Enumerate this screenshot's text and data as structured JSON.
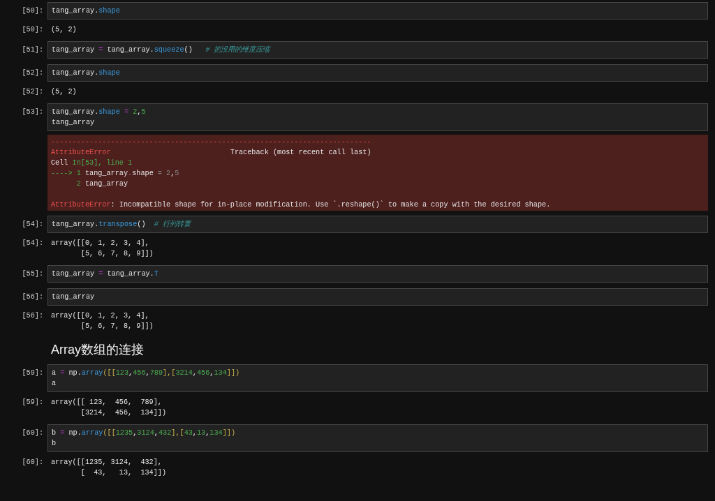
{
  "cells": [
    {
      "kind": "input",
      "prompt": "[50]:",
      "lines": [
        [
          {
            "text": "tang_array.",
            "kind": "plain"
          },
          {
            "text": "shape",
            "kind": "attr"
          }
        ]
      ]
    },
    {
      "kind": "output",
      "prompt": "[50]:",
      "lines": [
        "(5, 2)"
      ]
    },
    {
      "kind": "input",
      "prompt": "[51]:",
      "lines": [
        [
          {
            "text": "tang_array ",
            "kind": "plain"
          },
          {
            "text": "=",
            "kind": "op"
          },
          {
            "text": " tang_array.",
            "kind": "plain"
          },
          {
            "text": "squeeze",
            "kind": "attr"
          },
          {
            "text": "()   ",
            "kind": "plain"
          },
          {
            "text": "# 把没用的维度压缩",
            "kind": "comment"
          }
        ]
      ]
    },
    {
      "kind": "input",
      "prompt": "[52]:",
      "lines": [
        [
          {
            "text": "tang_array.",
            "kind": "plain"
          },
          {
            "text": "shape",
            "kind": "attr"
          }
        ]
      ]
    },
    {
      "kind": "output",
      "prompt": "[52]:",
      "lines": [
        "(5, 2)"
      ]
    },
    {
      "kind": "input",
      "prompt": "[53]:",
      "lines": [
        [
          {
            "text": "tang_array.",
            "kind": "plain"
          },
          {
            "text": "shape",
            "kind": "attr"
          },
          {
            "text": " = ",
            "kind": "op"
          },
          {
            "text": "2",
            "kind": "num"
          },
          {
            "text": ",",
            "kind": "plain"
          },
          {
            "text": "5",
            "kind": "num"
          }
        ],
        [
          {
            "text": "tang_array",
            "kind": "plain"
          }
        ]
      ]
    },
    {
      "kind": "error",
      "traceback": [
        [
          {
            "text": "---------------------------------------------------------------------------",
            "kind": "err"
          }
        ],
        [
          {
            "text": "AttributeError",
            "kind": "err"
          },
          {
            "text": "                            Traceback (most recent call last)",
            "kind": "plain"
          }
        ],
        [
          {
            "text": "Cell ",
            "kind": "plain"
          },
          {
            "text": "In[53], line 1",
            "kind": "num"
          }
        ],
        [
          {
            "text": "----> 1",
            "kind": "num"
          },
          {
            "text": " tang_array",
            "kind": "plain"
          },
          {
            "text": ".",
            "kind": "dim"
          },
          {
            "text": "shape ",
            "kind": "plain"
          },
          {
            "text": "= 2",
            "kind": "dim"
          },
          {
            "text": ",",
            "kind": "plain"
          },
          {
            "text": "5",
            "kind": "dim"
          }
        ],
        [
          {
            "text": "      2",
            "kind": "num"
          },
          {
            "text": " tang_array",
            "kind": "plain"
          }
        ]
      ],
      "message": [
        [
          {
            "text": "AttributeError",
            "kind": "err"
          },
          {
            "text": ": Incompatible shape for in-place modification. Use `.reshape()` to make a copy with the desired shape.",
            "kind": "plain"
          }
        ]
      ]
    },
    {
      "kind": "input",
      "prompt": "[54]:",
      "lines": [
        [
          {
            "text": "tang_array.",
            "kind": "plain"
          },
          {
            "text": "transpose",
            "kind": "attr"
          },
          {
            "text": "()  ",
            "kind": "plain"
          },
          {
            "text": "# 行列转置",
            "kind": "comment"
          }
        ]
      ]
    },
    {
      "kind": "output",
      "prompt": "[54]:",
      "lines": [
        "array([[0, 1, 2, 3, 4],",
        "       [5, 6, 7, 8, 9]])"
      ]
    },
    {
      "kind": "input",
      "prompt": "[55]:",
      "lines": [
        [
          {
            "text": "tang_array ",
            "kind": "plain"
          },
          {
            "text": "=",
            "kind": "op"
          },
          {
            "text": " tang_array.",
            "kind": "plain"
          },
          {
            "text": "T",
            "kind": "attr"
          }
        ]
      ]
    },
    {
      "kind": "input",
      "prompt": "[56]:",
      "lines": [
        [
          {
            "text": "tang_array",
            "kind": "plain"
          }
        ]
      ]
    },
    {
      "kind": "output",
      "prompt": "[56]:",
      "lines": [
        "array([[0, 1, 2, 3, 4],",
        "       [5, 6, 7, 8, 9]])"
      ]
    },
    {
      "kind": "heading",
      "text": "Array数组的连接"
    },
    {
      "kind": "input",
      "prompt": "[59]:",
      "lines": [
        [
          {
            "text": "a ",
            "kind": "plain"
          },
          {
            "text": "=",
            "kind": "op"
          },
          {
            "text": " np.",
            "kind": "plain"
          },
          {
            "text": "array",
            "kind": "attr"
          },
          {
            "text": "([[",
            "kind": "bracket"
          },
          {
            "text": "123",
            "kind": "num"
          },
          {
            "text": ",",
            "kind": "plain"
          },
          {
            "text": "456",
            "kind": "num"
          },
          {
            "text": ",",
            "kind": "plain"
          },
          {
            "text": "789",
            "kind": "num"
          },
          {
            "text": "],[",
            "kind": "bracket"
          },
          {
            "text": "3214",
            "kind": "num"
          },
          {
            "text": ",",
            "kind": "plain"
          },
          {
            "text": "456",
            "kind": "num"
          },
          {
            "text": ",",
            "kind": "plain"
          },
          {
            "text": "134",
            "kind": "num"
          },
          {
            "text": "]])",
            "kind": "bracket"
          }
        ],
        [
          {
            "text": "a",
            "kind": "plain"
          }
        ]
      ]
    },
    {
      "kind": "output",
      "prompt": "[59]:",
      "lines": [
        "array([[ 123,  456,  789],",
        "       [3214,  456,  134]])"
      ]
    },
    {
      "kind": "input",
      "prompt": "[60]:",
      "lines": [
        [
          {
            "text": "b ",
            "kind": "plain"
          },
          {
            "text": "=",
            "kind": "op"
          },
          {
            "text": " np.",
            "kind": "plain"
          },
          {
            "text": "array",
            "kind": "attr"
          },
          {
            "text": "([[",
            "kind": "bracket"
          },
          {
            "text": "1235",
            "kind": "num"
          },
          {
            "text": ",",
            "kind": "plain"
          },
          {
            "text": "3124",
            "kind": "num"
          },
          {
            "text": ",",
            "kind": "plain"
          },
          {
            "text": "432",
            "kind": "num"
          },
          {
            "text": "],[",
            "kind": "bracket"
          },
          {
            "text": "43",
            "kind": "num"
          },
          {
            "text": ",",
            "kind": "plain"
          },
          {
            "text": "13",
            "kind": "num"
          },
          {
            "text": ",",
            "kind": "plain"
          },
          {
            "text": "134",
            "kind": "num"
          },
          {
            "text": "]])",
            "kind": "bracket"
          }
        ],
        [
          {
            "text": "b",
            "kind": "plain"
          }
        ]
      ]
    },
    {
      "kind": "output",
      "prompt": "[60]:",
      "lines": [
        "array([[1235, 3124,  432],",
        "       [  43,   13,  134]])"
      ]
    }
  ]
}
